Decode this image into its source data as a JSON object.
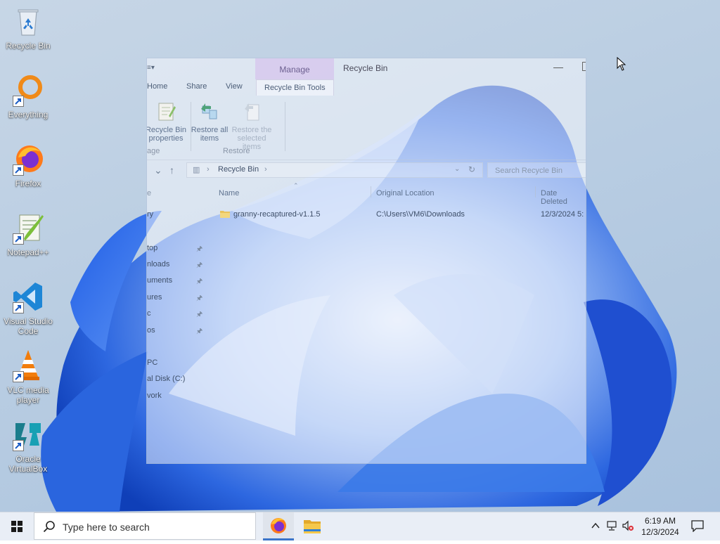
{
  "desktop": {
    "icons": [
      {
        "label": "Recycle Bin",
        "icon": "recycle-bin-icon"
      },
      {
        "label": "Everything",
        "icon": "everything-icon"
      },
      {
        "label": "Firefox",
        "icon": "firefox-icon"
      },
      {
        "label": "Notepad++",
        "icon": "notepad-plus-plus-icon"
      },
      {
        "label": "Visual Studio Code",
        "icon": "vscode-icon"
      },
      {
        "label": "VLC media player",
        "icon": "vlc-icon"
      },
      {
        "label": "Oracle VirtualBox",
        "icon": "virtualbox-icon"
      }
    ]
  },
  "explorer": {
    "title": "Recycle Bin",
    "manage_tab": "Manage",
    "ribbon_tabs": {
      "home": "Home",
      "share": "Share",
      "view": "View",
      "tools": "Recycle Bin Tools"
    },
    "ribbon_buttons": {
      "properties": "Recycle Bin properties",
      "restore_all": "Restore all items",
      "restore_selected": "Restore the selected items"
    },
    "ribbon_groups": {
      "manage": "age",
      "restore": "Restore"
    },
    "address": {
      "path": "Recycle Bin"
    },
    "search_placeholder": "Search Recycle Bin",
    "nav": {
      "header": "e",
      "items": [
        "ry",
        "top",
        "nloads",
        "uments",
        "ures",
        "c",
        "os",
        "PC",
        "al Disk (C:)",
        "vork"
      ]
    },
    "columns": {
      "name": "Name",
      "original_location": "Original Location",
      "date_deleted": "Date Deleted"
    },
    "rows": [
      {
        "name": "granny-recaptured-v1.1.5",
        "original_location": "C:\\Users\\VM6\\Downloads",
        "date_deleted": "12/3/2024 5:"
      }
    ]
  },
  "taskbar": {
    "search_placeholder": "Type here to search",
    "apps": [
      {
        "name": "firefox",
        "icon": "firefox-icon",
        "active": true
      },
      {
        "name": "file-explorer",
        "icon": "folder-icon",
        "active": false
      }
    ],
    "time": "6:19 AM",
    "date": "12/3/2024"
  },
  "colors": {
    "accent": "#3b74c9",
    "manage_tab": "#d6c4ec",
    "taskbar": "#e9eef6"
  }
}
